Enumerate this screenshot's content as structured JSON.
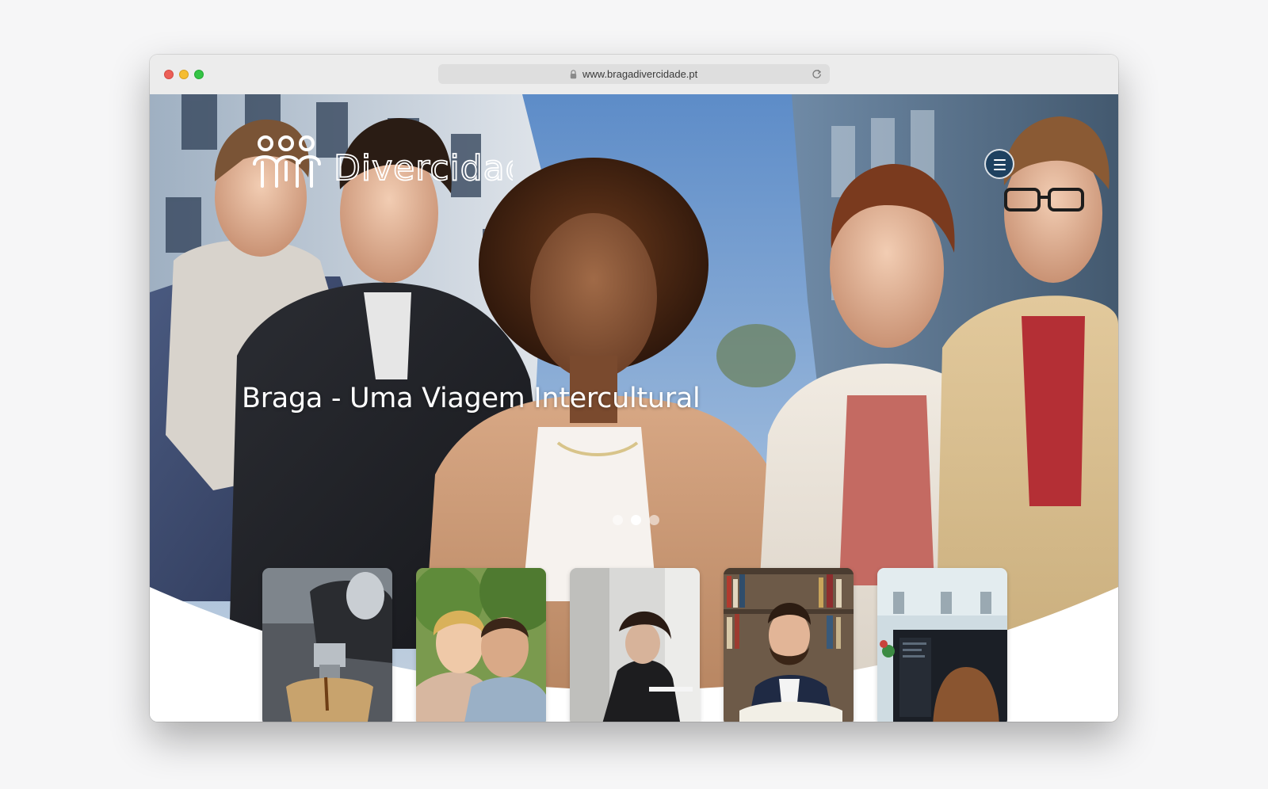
{
  "browser": {
    "url": "www.bragadivercidade.pt"
  },
  "site": {
    "logo_text": "Divercidade",
    "hero_title": "Braga - Uma Viagem Intercultural"
  },
  "carousel": {
    "slide_count": 3,
    "active_slide": 2
  },
  "icons": {
    "lock": "lock-icon",
    "reload": "reload-icon",
    "menu": "hamburger-menu-icon",
    "logo": "people-logo-icon"
  },
  "colors": {
    "menu_button": "#1e4160",
    "hero_text": "#ffffff"
  }
}
